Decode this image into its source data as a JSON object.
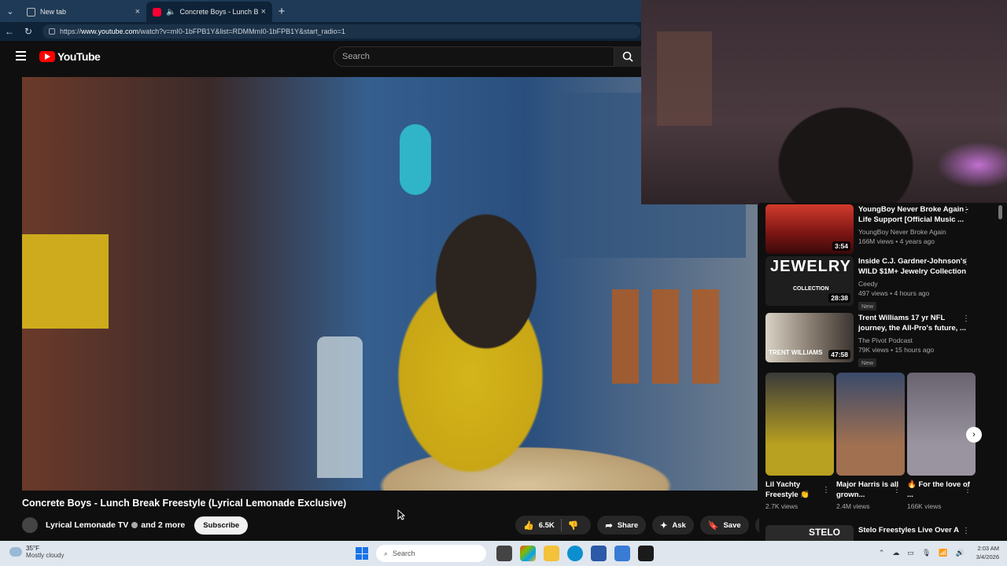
{
  "browser": {
    "tabs": [
      {
        "label": "New tab",
        "active": false
      },
      {
        "label": "Concrete Boys - Lunch Break",
        "active": true
      }
    ],
    "close_glyph": "×",
    "new_tab_glyph": "+",
    "url_prefix": "https://",
    "url_host": "www.youtube.com",
    "url_path": "/watch?v=mI0-1bFPB1Y&list=RDMMmI0-1bFPB1Y&start_radio=1"
  },
  "youtube": {
    "logo_text": "YouTube",
    "search_placeholder": "Search"
  },
  "video": {
    "title": "Concrete Boys - Lunch Break Freestyle (Lyrical Lemonade Exclusive)",
    "channel": "Lyrical Lemonade TV",
    "more_channels": "and 2 more",
    "subscribe_label": "Subscribe",
    "likes": "6.5K",
    "share_label": "Share",
    "ask_label": "Ask",
    "save_label": "Save"
  },
  "recommendations": [
    {
      "title": "YoungBoy Never Broke Again - Life Support [Official Music ...",
      "channel": "YoungBoy Never Broke Again",
      "stats": "166M views • 4 years ago",
      "duration": "3:54",
      "is_new": false,
      "thumb_color": "#8a1e1e"
    },
    {
      "title": "Inside C.J. Gardner-Johnson's WILD $1M+ Jewelry Collection",
      "channel": "Ceedy",
      "stats": "497 views • 4 hours ago",
      "duration": "28:38",
      "is_new": true,
      "thumb_color": "#2a2a2a"
    },
    {
      "title": "Trent Williams 17 yr NFL journey, the All-Pro's future, ...",
      "channel": "The Pivot Podcast",
      "stats": "79K views • 15 hours ago",
      "duration": "47:58",
      "is_new": true,
      "thumb_color": "#3a3330"
    }
  ],
  "new_badge": "New",
  "thumb_texts": [
    "JEWELRY",
    "COLLECTION",
    "TRENT WILLIAMS"
  ],
  "shorts": [
    {
      "title": "Lil Yachty Freestyle 👏",
      "views": "2.7K views",
      "color": "#b8a020"
    },
    {
      "title": "Major Harris is all grown...",
      "views": "2.4M views",
      "color": "#6a4a3a"
    },
    {
      "title": "🔥 For the love of ...",
      "views": "166K views",
      "color": "#8a8490"
    }
  ],
  "next_rec": {
    "title": "Stelo Freestyles Live Over A",
    "thumb_text": "STELO"
  },
  "taskbar": {
    "temp": "35°F",
    "weather": "Mostly cloudy",
    "search_label": "Search",
    "time": "2:03 AM",
    "date": "3/4/2026"
  }
}
